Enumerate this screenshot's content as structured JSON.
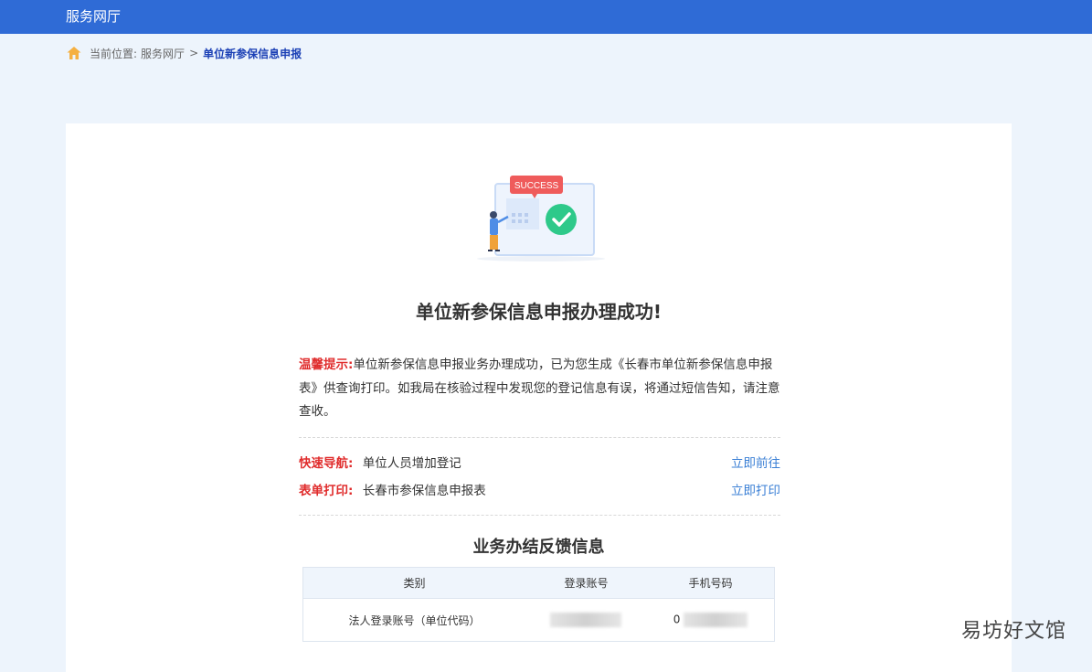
{
  "header": {
    "title": "服务网厅"
  },
  "breadcrumb": {
    "prefix": "当前位置:",
    "parent": "服务网厅",
    "separator": ">",
    "current": "单位新参保信息申报"
  },
  "illustration": {
    "badge_text": "SUCCESS"
  },
  "result": {
    "title": "单位新参保信息申报办理成功!"
  },
  "notice": {
    "label": "温馨提示:",
    "text": "单位新参保信息申报业务办理成功，已为您生成《长春市单位新参保信息申报表》供查询打印。如我局在核验过程中发现您的登记信息有误，将通过短信告知，请注意查收。"
  },
  "actions": [
    {
      "label": "快速导航:",
      "text": "单位人员增加登记",
      "link": "立即前往"
    },
    {
      "label": "表单打印:",
      "text": "长春市参保信息申报表",
      "link": "立即打印"
    }
  ],
  "feedback": {
    "title": "业务办结反馈信息",
    "headers": [
      "类别",
      "登录账号",
      "手机号码"
    ],
    "rows": [
      {
        "category": "法人登录账号（单位代码）",
        "account": "",
        "phone_prefix": "0"
      }
    ]
  },
  "watermark": "易坊好文馆",
  "colors": {
    "header_bg": "#2f6bd6",
    "page_bg": "#edf4fc",
    "accent_red": "#e02d2d",
    "link_blue": "#3a7fd5",
    "success_green": "#2ec98a"
  }
}
